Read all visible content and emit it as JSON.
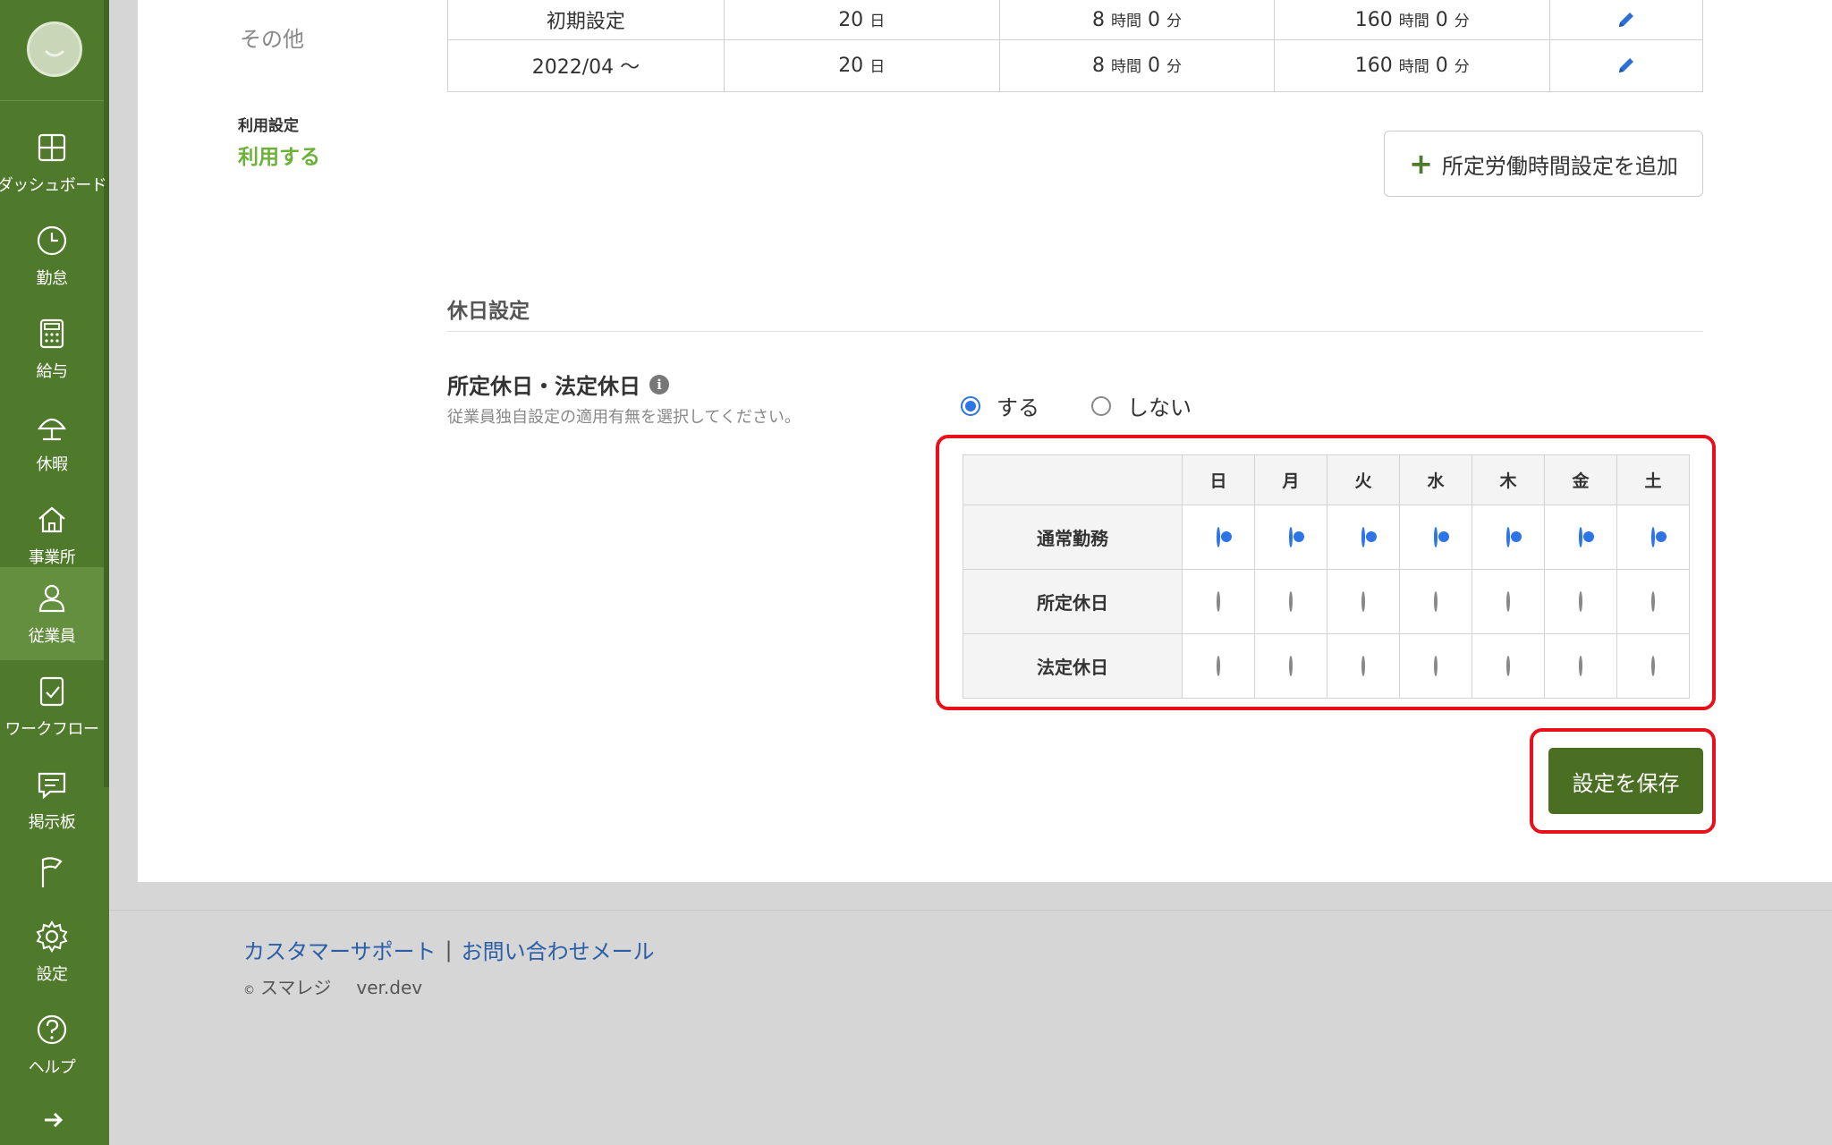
{
  "sidebar": {
    "items": [
      {
        "label": "ダッシュボード",
        "icon": "dashboard-icon"
      },
      {
        "label": "勤怠",
        "icon": "clock-icon"
      },
      {
        "label": "給与",
        "icon": "calculator-icon"
      },
      {
        "label": "休暇",
        "icon": "umbrella-icon"
      },
      {
        "label": "事業所",
        "icon": "home-icon"
      },
      {
        "label": "従業員",
        "icon": "user-icon"
      },
      {
        "label": "ワークフロー",
        "icon": "workflow-icon"
      },
      {
        "label": "掲示板",
        "icon": "chat-icon"
      },
      {
        "label": "",
        "icon": "flag-icon"
      },
      {
        "label": "設定",
        "icon": "gear-icon"
      },
      {
        "label": "ヘルプ",
        "icon": "help-icon"
      }
    ],
    "active": "従業員",
    "colors": {
      "bg": "#4f7a2c",
      "active": "#638f3e"
    }
  },
  "main": {
    "other_label": "その他",
    "usage": {
      "title": "利用設定",
      "value": "利用する"
    },
    "work_table": {
      "rows": [
        {
          "period": "初期設定",
          "days": "20",
          "days_unit": "日",
          "hours": "8",
          "hours_unit": "時間",
          "minutes": "0",
          "minutes_unit": "分",
          "total_hours": "160",
          "total_minutes": "0"
        },
        {
          "period": "2022/04 〜",
          "days": "20",
          "days_unit": "日",
          "hours": "8",
          "hours_unit": "時間",
          "minutes": "0",
          "minutes_unit": "分",
          "total_hours": "160",
          "total_minutes": "0"
        }
      ]
    },
    "add_button_label": "所定労働時間設定を追加",
    "holiday_section_title": "休日設定",
    "holiday_field": {
      "label": "所定休日・法定休日",
      "help": "従業員独自設定の適用有無を選択してください。",
      "options": [
        {
          "label": "する",
          "checked": true
        },
        {
          "label": "しない",
          "checked": false
        }
      ]
    },
    "day_table": {
      "days": [
        "日",
        "月",
        "火",
        "水",
        "木",
        "金",
        "土"
      ],
      "rows": [
        {
          "label": "通常勤務",
          "checked": true
        },
        {
          "label": "所定休日",
          "checked": false
        },
        {
          "label": "法定休日",
          "checked": false
        }
      ]
    },
    "save_button_label": "設定を保存"
  },
  "footer": {
    "support_link": "カスタマーサポート",
    "separator": "|",
    "mail_link": "お問い合わせメール",
    "copyright_mark": "©",
    "brand": "スマレジ",
    "version": "ver.dev"
  },
  "colors": {
    "accent_green": "#6cb23a",
    "save_button": "#4a6f23",
    "highlight": "#e8101a",
    "radio_blue": "#2d74e8",
    "link": "#2a5fa8"
  }
}
